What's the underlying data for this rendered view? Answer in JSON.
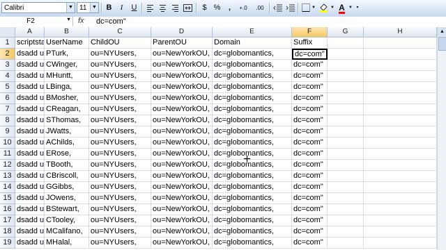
{
  "toolbar": {
    "font_name": "Calibri",
    "font_size": "11",
    "bold": "B",
    "italic": "I",
    "underline": "U",
    "currency": "$",
    "percent": "%",
    "comma": ",",
    "increase_decimal": "+.0",
    "decrease_decimal": ".00",
    "colors": {
      "fill": "#ffff00",
      "font": "#ff0000"
    }
  },
  "formula_bar": {
    "name_box": "F2",
    "fx": "fx",
    "content": "dc=com\""
  },
  "columns": [
    "A",
    "B",
    "C",
    "D",
    "E",
    "F",
    "G",
    "H"
  ],
  "selected": {
    "column": "F",
    "row": "2"
  },
  "rows": [
    {
      "num": "1",
      "cells": [
        "scriptstart",
        "UserName",
        "ChildOU",
        "ParentOU",
        "Domain",
        "Suffix"
      ]
    },
    {
      "num": "2",
      "cells": [
        "dsadd user \"cn=",
        "PTurk,",
        "ou=NYUsers,",
        "ou=NewYorkOU,",
        "dc=globomantics,",
        "dc=com\""
      ]
    },
    {
      "num": "3",
      "cells": [
        "dsadd user \"cn=",
        "CWinger,",
        "ou=NYUsers,",
        "ou=NewYorkOU,",
        "dc=globomantics,",
        "dc=com\""
      ]
    },
    {
      "num": "4",
      "cells": [
        "dsadd user \"cn=",
        "MHuntt,",
        "ou=NYUsers,",
        "ou=NewYorkOU,",
        "dc=globomantics,",
        "dc=com\""
      ]
    },
    {
      "num": "5",
      "cells": [
        "dsadd user \"cn=",
        "LBinga,",
        "ou=NYUsers,",
        "ou=NewYorkOU,",
        "dc=globomantics,",
        "dc=com\""
      ]
    },
    {
      "num": "6",
      "cells": [
        "dsadd user \"cn=",
        "BMosher,",
        "ou=NYUsers,",
        "ou=NewYorkOU,",
        "dc=globomantics,",
        "dc=com\""
      ]
    },
    {
      "num": "7",
      "cells": [
        "dsadd user \"cn=",
        "CReagan,",
        "ou=NYUsers,",
        "ou=NewYorkOU,",
        "dc=globomantics,",
        "dc=com\""
      ]
    },
    {
      "num": "8",
      "cells": [
        "dsadd user \"cn=",
        "SThomas,",
        "ou=NYUsers,",
        "ou=NewYorkOU,",
        "dc=globomantics,",
        "dc=com\""
      ]
    },
    {
      "num": "9",
      "cells": [
        "dsadd user \"cn=",
        "JWatts,",
        "ou=NYUsers,",
        "ou=NewYorkOU,",
        "dc=globomantics,",
        "dc=com\""
      ]
    },
    {
      "num": "10",
      "cells": [
        "dsadd user \"cn=",
        "AChilds,",
        "ou=NYUsers,",
        "ou=NewYorkOU,",
        "dc=globomantics,",
        "dc=com\""
      ]
    },
    {
      "num": "11",
      "cells": [
        "dsadd user \"cn=",
        "ERose,",
        "ou=NYUsers,",
        "ou=NewYorkOU,",
        "dc=globomantics,",
        "dc=com\""
      ]
    },
    {
      "num": "12",
      "cells": [
        "dsadd user \"cn=",
        "TBooth,",
        "ou=NYUsers,",
        "ou=NewYorkOU,",
        "dc=globomantics,",
        "dc=com\""
      ]
    },
    {
      "num": "13",
      "cells": [
        "dsadd user \"cn=",
        "CBriscoll,",
        "ou=NYUsers,",
        "ou=NewYorkOU,",
        "dc=globomantics,",
        "dc=com\""
      ]
    },
    {
      "num": "14",
      "cells": [
        "dsadd user \"cn=",
        "GGibbs,",
        "ou=NYUsers,",
        "ou=NewYorkOU,",
        "dc=globomantics,",
        "dc=com\""
      ]
    },
    {
      "num": "15",
      "cells": [
        "dsadd user \"cn=",
        "JOwens,",
        "ou=NYUsers,",
        "ou=NewYorkOU,",
        "dc=globomantics,",
        "dc=com\""
      ]
    },
    {
      "num": "16",
      "cells": [
        "dsadd user \"cn=",
        "BStewart,",
        "ou=NYUsers,",
        "ou=NewYorkOU,",
        "dc=globomantics,",
        "dc=com\""
      ]
    },
    {
      "num": "17",
      "cells": [
        "dsadd user \"cn=",
        "CTooley,",
        "ou=NYUsers,",
        "ou=NewYorkOU,",
        "dc=globomantics,",
        "dc=com\""
      ]
    },
    {
      "num": "18",
      "cells": [
        "dsadd user \"cn=",
        "MCalifano,",
        "ou=NYUsers,",
        "ou=NewYorkOU,",
        "dc=globomantics,",
        "dc=com\""
      ]
    },
    {
      "num": "19",
      "cells": [
        "dsadd user \"cn=",
        "MHalal,",
        "ou=NYUsers,",
        "ou=NewYorkOU,",
        "dc=globomantics,",
        "dc=com\""
      ]
    }
  ]
}
